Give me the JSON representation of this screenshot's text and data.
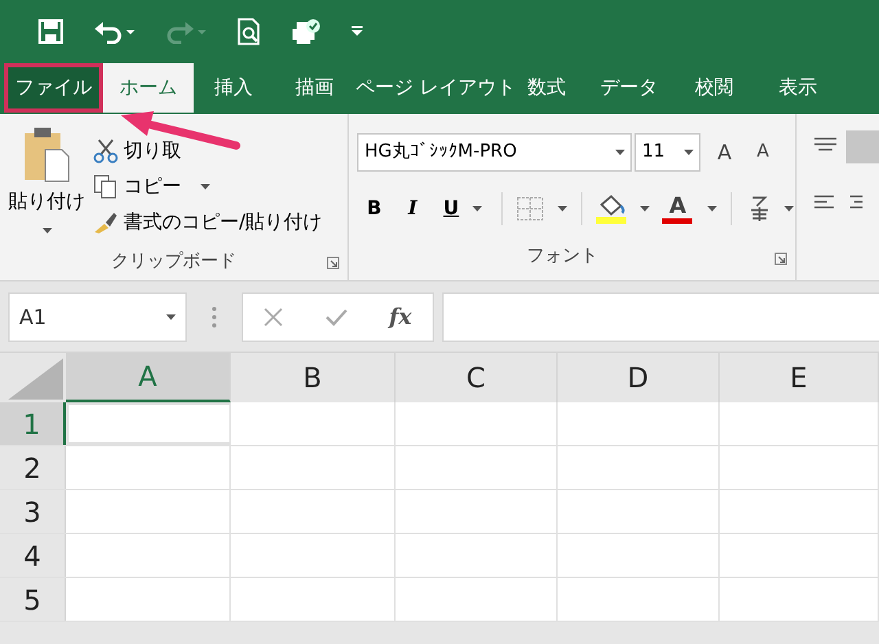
{
  "tabs": [
    {
      "label": "ファイル",
      "selected": false,
      "highlighted": true
    },
    {
      "label": "ホーム",
      "selected": true,
      "highlighted": false
    },
    {
      "label": "挿入",
      "selected": false,
      "highlighted": false
    },
    {
      "label": "描画",
      "selected": false,
      "highlighted": false
    },
    {
      "label": "ページ レイアウト",
      "selected": false,
      "highlighted": false
    },
    {
      "label": "数式",
      "selected": false,
      "highlighted": false
    },
    {
      "label": "データ",
      "selected": false,
      "highlighted": false
    },
    {
      "label": "校閲",
      "selected": false,
      "highlighted": false
    },
    {
      "label": "表示",
      "selected": false,
      "highlighted": false
    }
  ],
  "clipboard": {
    "paste": "貼り付け",
    "cut": "切り取",
    "copy": "コピー",
    "format_painter": "書式のコピー/貼り付け",
    "group_label": "クリップボード"
  },
  "font": {
    "font_name": "HG丸ｺﾞｼｯｸM-PRO",
    "font_size": "11",
    "grow": "A",
    "shrink": "A",
    "bold": "B",
    "italic": "I",
    "underline": "U",
    "font_color": "A",
    "group_label": "フォント"
  },
  "formula_bar": {
    "name_box": "A1",
    "function_label": "fx"
  },
  "columns": [
    {
      "label": "A",
      "selected": true
    },
    {
      "label": "B",
      "selected": false
    },
    {
      "label": "C",
      "selected": false
    },
    {
      "label": "D",
      "selected": false
    },
    {
      "label": "E",
      "selected": false
    }
  ],
  "rows": [
    {
      "label": "1",
      "selected": true
    },
    {
      "label": "2",
      "selected": false
    },
    {
      "label": "3",
      "selected": false
    },
    {
      "label": "4",
      "selected": false
    },
    {
      "label": "5",
      "selected": false
    }
  ]
}
